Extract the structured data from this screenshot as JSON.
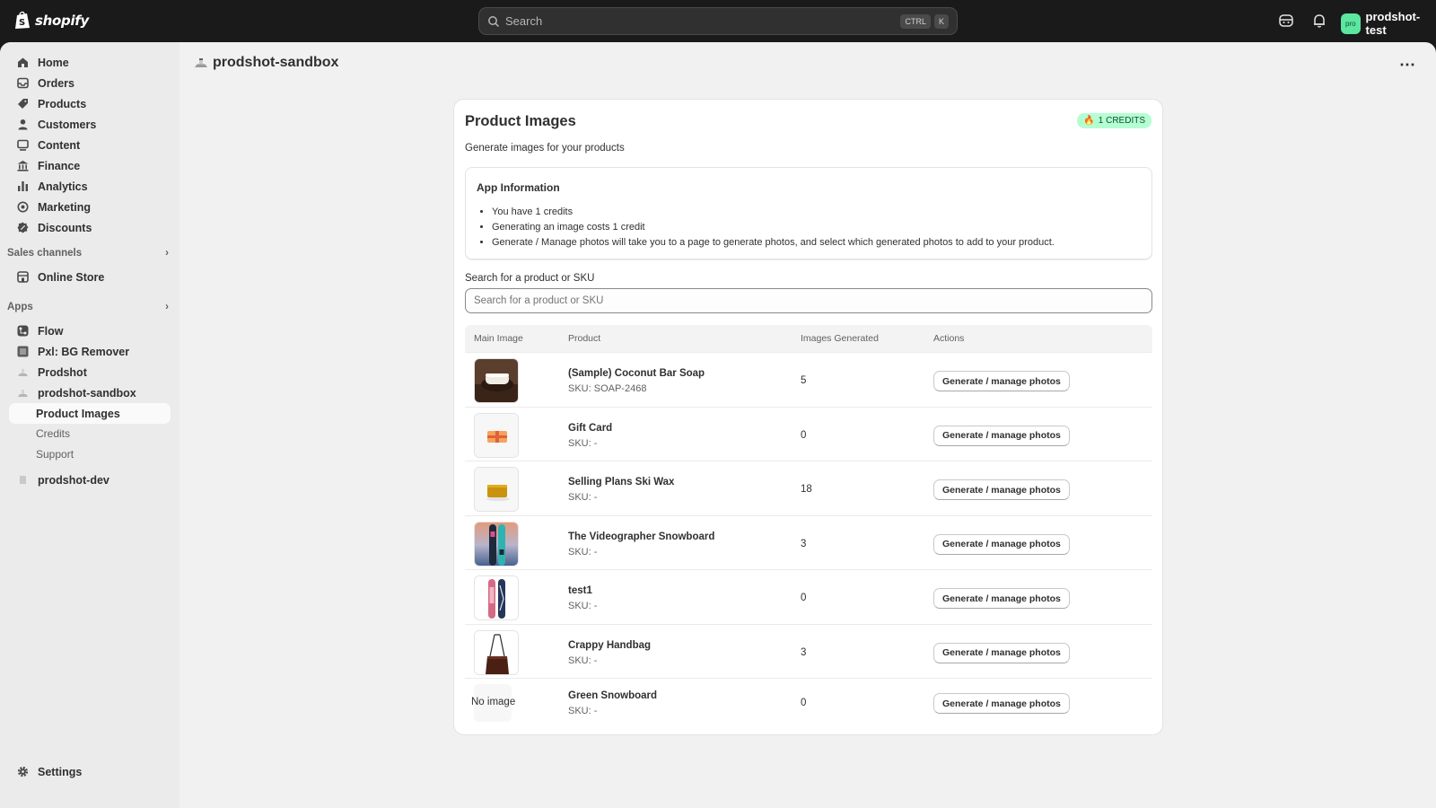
{
  "topbar": {
    "logo": "shopify",
    "search_placeholder": "Search",
    "shortcut_1": "CTRL",
    "shortcut_2": "K",
    "user_initials": "pro",
    "user_name": "prodshot-test"
  },
  "sidebar": {
    "items": [
      {
        "label": "Home",
        "icon": "home-icon"
      },
      {
        "label": "Orders",
        "icon": "orders-icon"
      },
      {
        "label": "Products",
        "icon": "tag-icon"
      },
      {
        "label": "Customers",
        "icon": "person-icon"
      },
      {
        "label": "Content",
        "icon": "content-icon"
      },
      {
        "label": "Finance",
        "icon": "bank-icon"
      },
      {
        "label": "Analytics",
        "icon": "bar-chart-icon"
      },
      {
        "label": "Marketing",
        "icon": "target-icon"
      },
      {
        "label": "Discounts",
        "icon": "discount-icon"
      }
    ],
    "sales_channels_label": "Sales channels",
    "online_store": "Online Store",
    "apps_label": "Apps",
    "apps": [
      "Flow",
      "Pxl: BG Remover",
      "Prodshot",
      "prodshot-sandbox"
    ],
    "active_sub": "Product Images",
    "sub_items": [
      "Credits",
      "Support"
    ],
    "dev_app": "prodshot-dev",
    "settings": "Settings"
  },
  "page": {
    "title": "prodshot-sandbox"
  },
  "card": {
    "title": "Product Images",
    "credits_badge": "1 CREDITS",
    "subtitle": "Generate images for your products",
    "info_title": "App Information",
    "info_items": [
      "You have 1 credits",
      "Generating an image costs 1 credit",
      "Generate / Manage photos will take you to a page to generate photos, and select which generated photos to add to your product."
    ],
    "search_label": "Search for a product or SKU",
    "search_placeholder": "Search for a product or SKU"
  },
  "table": {
    "headers": [
      "Main Image",
      "Product",
      "Images Generated",
      "Actions"
    ],
    "button_label": "Generate / manage photos",
    "rows": [
      {
        "name": "(Sample) Coconut Bar Soap",
        "sku": "SKU: SOAP-2468",
        "count": "5",
        "image": "soap"
      },
      {
        "name": "Gift Card",
        "sku": "SKU: -",
        "count": "0",
        "image": "giftcard"
      },
      {
        "name": "Selling Plans Ski Wax",
        "sku": "SKU: -",
        "count": "18",
        "image": "wax"
      },
      {
        "name": "The Videographer Snowboard",
        "sku": "SKU: -",
        "count": "3",
        "image": "videographer"
      },
      {
        "name": "test1",
        "sku": "SKU: -",
        "count": "0",
        "image": "boards"
      },
      {
        "name": "Crappy Handbag",
        "sku": "SKU: -",
        "count": "3",
        "image": "handbag"
      },
      {
        "name": "Green Snowboard",
        "sku": "SKU: -",
        "count": "0",
        "image": "none",
        "no_image_text": "No image"
      }
    ]
  }
}
